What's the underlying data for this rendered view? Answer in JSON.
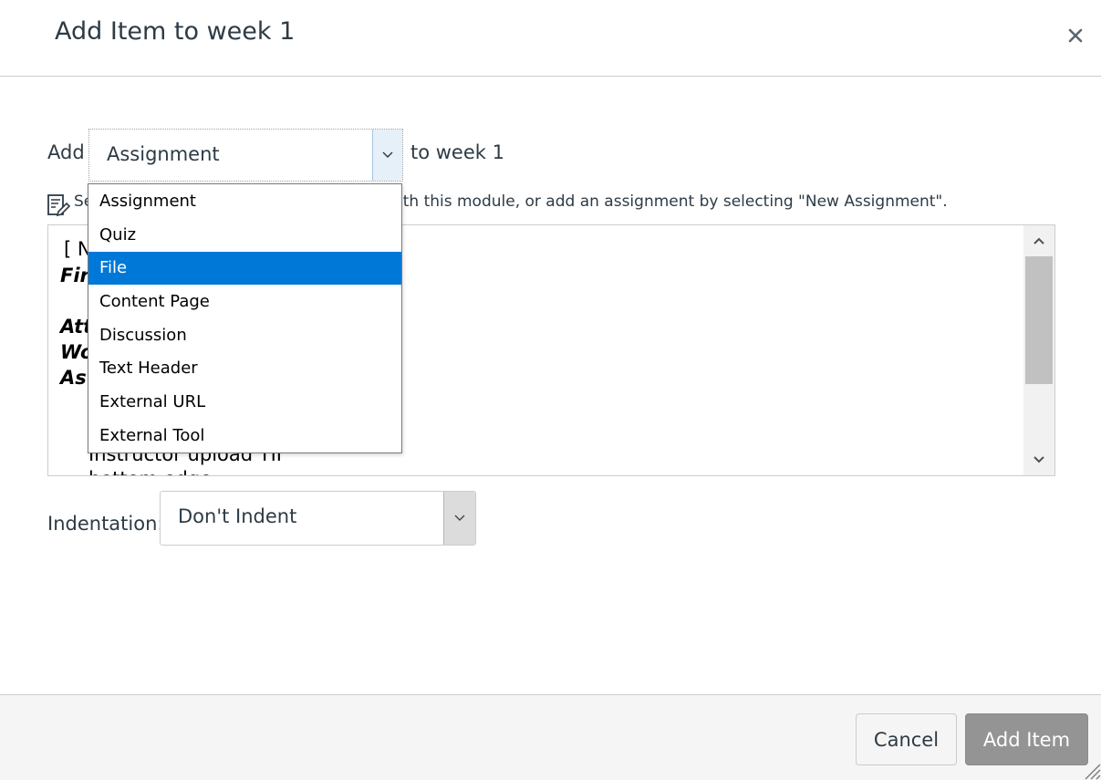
{
  "dialog": {
    "title": "Add Item to week 1",
    "close_icon": "close-icon"
  },
  "add_row": {
    "prefix": "Add",
    "selected_type": "Assignment",
    "suffix": "to week 1"
  },
  "instructions": {
    "icon": "edit-note-icon",
    "visible_prefix": "Se",
    "visible_suffix": "ith this module, or add an assignment by selecting \"New Assignment\"."
  },
  "item_list": {
    "first_line": "[ N",
    "group_1": "Fir",
    "group_2": "Att",
    "group_3": "Wo",
    "group_4": "As",
    "partial_item": "Instructor upload TII",
    "cut_off_line": "bottom edge"
  },
  "type_dropdown": {
    "options": [
      "Assignment",
      "Quiz",
      "File",
      "Content Page",
      "Discussion",
      "Text Header",
      "External URL",
      "External Tool"
    ],
    "highlighted": "File"
  },
  "indentation": {
    "label": "Indentation:",
    "value": "Don't Indent"
  },
  "footer": {
    "cancel_label": "Cancel",
    "add_label": "Add Item"
  },
  "colors": {
    "highlight": "#0078d7",
    "primary_button_disabled": "#949494",
    "text": "#2d3b45"
  }
}
